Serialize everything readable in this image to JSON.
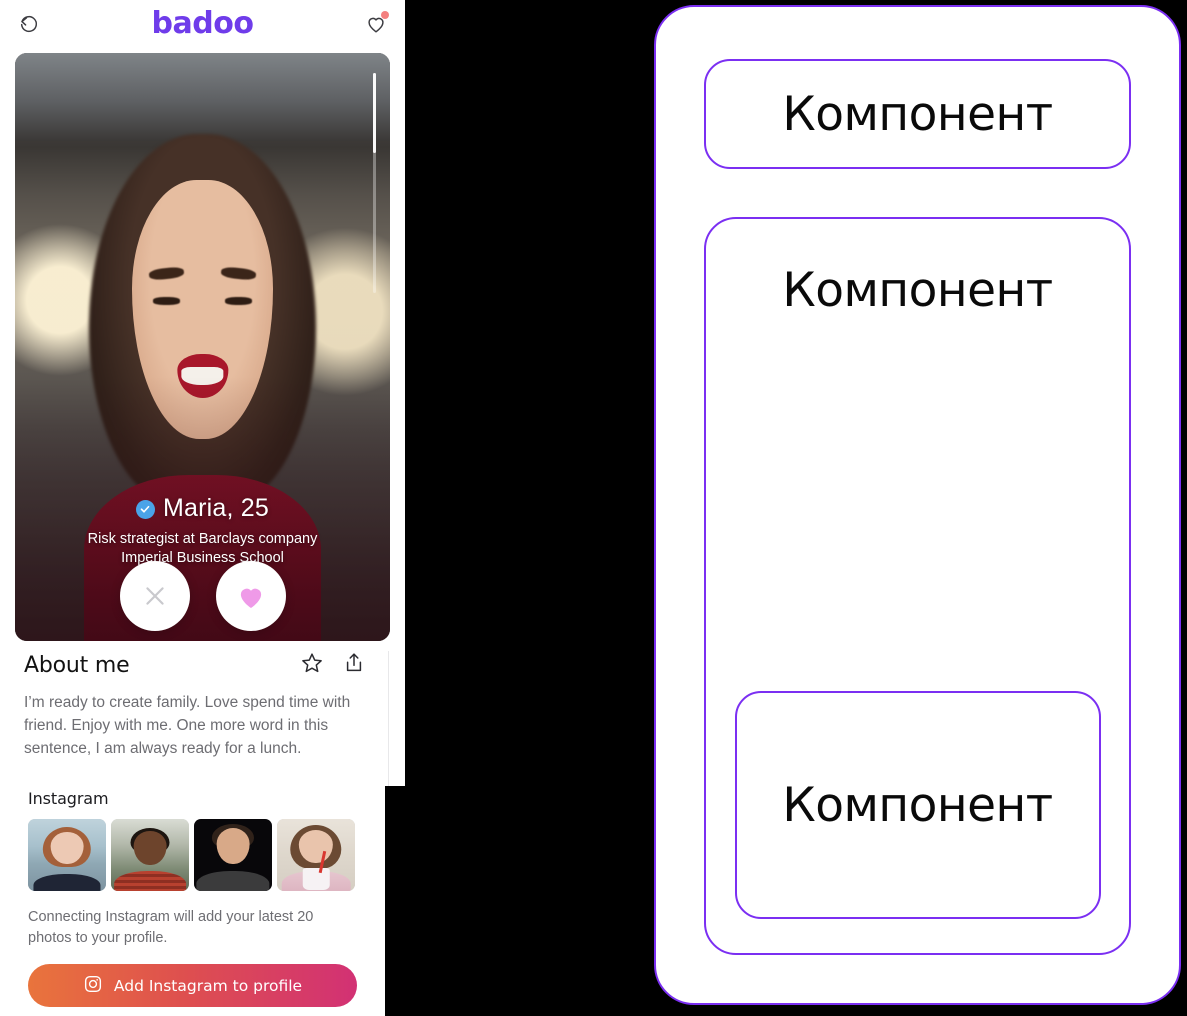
{
  "colors": {
    "brand_purple": "#6f3cea",
    "panel_border_purple": "#7b2ff2",
    "notification_dot": "#f4807f",
    "verified_blue": "#4aa3e8",
    "like_heart_pink": "#ef9ae8",
    "instagram_gradient_start": "#e9743c",
    "instagram_gradient_end": "#d23174",
    "background": "#000000"
  },
  "badoo": {
    "header": {
      "back_icon": "undo-rewind-icon",
      "brand": "badoo",
      "notifications_icon": "heart-outline-icon",
      "has_notification_dot": true
    },
    "photo": {
      "alt": "portrait of smiling woman in red top",
      "scroll_indicator_visible": true
    },
    "profile": {
      "name_age": "Maria, 25",
      "verified": true,
      "subtitle_line1": "Risk strategist at Barclays company",
      "subtitle_line2": "Imperial Business School"
    },
    "actions": [
      {
        "name": "pass-button",
        "icon": "close-x-icon"
      },
      {
        "name": "like-button",
        "icon": "heart-filled-icon"
      }
    ],
    "about": {
      "title": "About me",
      "favorite_icon": "star-outline-icon",
      "share_icon": "share-upload-icon",
      "text": "I’m ready to create family. Love spend time with friend. Enjoy with me. One more word in this sentence, I am always ready for a lunch."
    },
    "instagram": {
      "title": "Instagram",
      "thumbnails": [
        {
          "alt": "red-haired woman portrait"
        },
        {
          "alt": "man in red striped shirt"
        },
        {
          "alt": "man on black background"
        },
        {
          "alt": "woman with glasses drinking"
        }
      ],
      "note": "Connecting Instagram will add your latest 20 photos to your profile.",
      "button_label": "Add Instagram to profile",
      "button_icon": "instagram-icon"
    }
  },
  "component_panel": {
    "boxes": [
      {
        "label": "Компонент"
      },
      {
        "label": "Компонент"
      },
      {
        "label": "Компонент"
      }
    ]
  }
}
